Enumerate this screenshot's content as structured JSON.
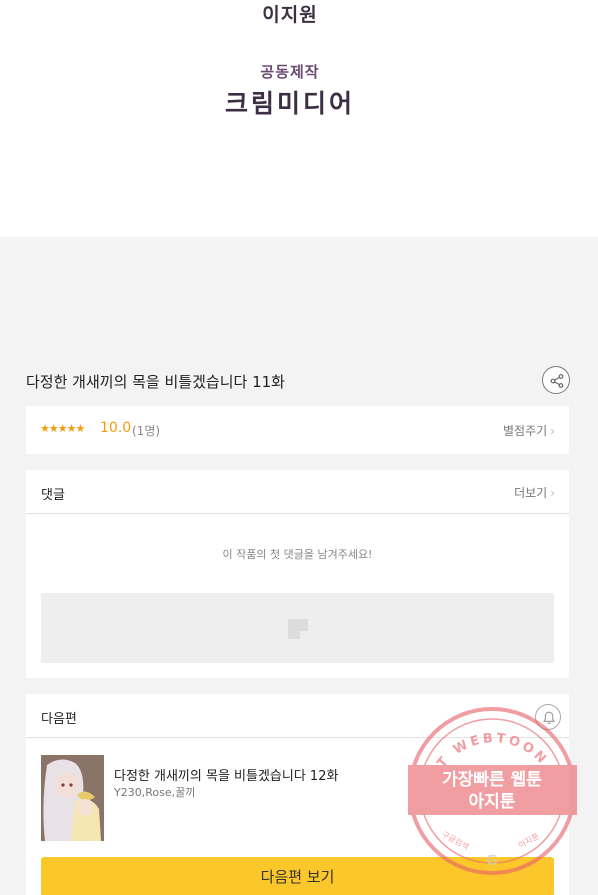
{
  "credits": {
    "author": "이지원",
    "coproduction_label": "공동제작",
    "studio": "크림미디어"
  },
  "episode": {
    "title": "다정한 개새끼의 목을 비틀겠습니다 11화"
  },
  "rating": {
    "stars": "★★★★★",
    "score": "10.0",
    "count": "(1명)",
    "rate_link": "별점주기"
  },
  "comments": {
    "header": "댓글",
    "more_link": "더보기",
    "empty_message": "이 작품의 첫 댓글을 남겨주세요!"
  },
  "next_episode": {
    "header": "다음편",
    "title": "다정한 개새끼의 목을 비틀겠습니다 12화",
    "authors": "Y230,Rose,꿀끼",
    "button_label": "다음편 보기"
  },
  "watermark": {
    "arc_text": "AGIT WEBTOON",
    "line1": "가장빠른 웹툰",
    "line2": "아지툰",
    "small_left": "구글검색",
    "small_right": "아지툰",
    "center_letter": "G"
  },
  "colors": {
    "accent_yellow": "#fcc72a",
    "star_orange": "#f39c12",
    "stamp_red": "#e8646a"
  },
  "icons": {
    "share": "share-icon",
    "bell": "bell-icon",
    "chevron": "chevron-right-icon",
    "ad": "ad-placeholder-icon"
  }
}
